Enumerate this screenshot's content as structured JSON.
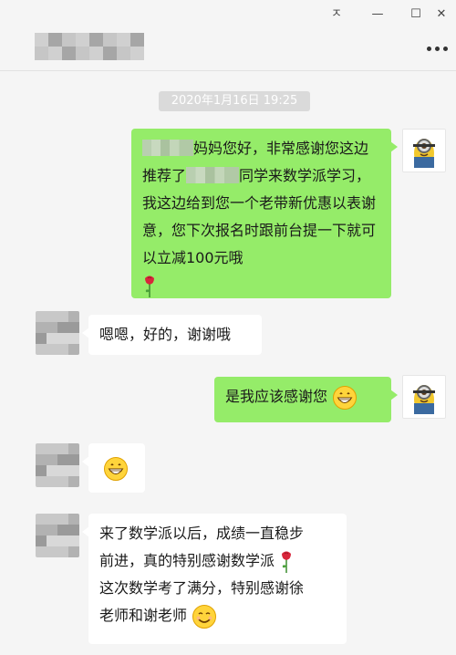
{
  "window": {
    "pin_glyph": "ㅈ",
    "minimize_glyph": "—",
    "maximize_glyph": "☐",
    "close_glyph": "✕"
  },
  "chat": {
    "timestamp": "2020年1月16日 19:25",
    "messages": [
      {
        "sender": "me",
        "parts": [
          "妈妈您好，非常感谢您这",
          "边推荐了",
          "同学来数学派学",
          "习，我这边给到您一个老带新优",
          "惠以表谢意，您下次报名时跟前",
          "台提一下就可以立减100元哦"
        ]
      },
      {
        "sender": "contact",
        "text": "嗯嗯，好的，谢谢哦"
      },
      {
        "sender": "me",
        "text": "是我应该感谢您"
      },
      {
        "sender": "contact",
        "text": ""
      },
      {
        "sender": "contact",
        "lines": [
          "来了数学派以后，成绩一直稳步",
          "前进，真的特别感谢数学派",
          "这次数学考了满分，特别感谢徐",
          "老师和谢老师"
        ]
      }
    ]
  },
  "icons": {
    "grin": "grinning-face-emoji",
    "rose": "rose-emoji",
    "smile": "smiling-face-emoji",
    "avatar_me": "minion-avatar"
  },
  "colors": {
    "my_bubble": "#95ec69",
    "their_bubble": "#ffffff",
    "background": "#f5f5f5"
  }
}
